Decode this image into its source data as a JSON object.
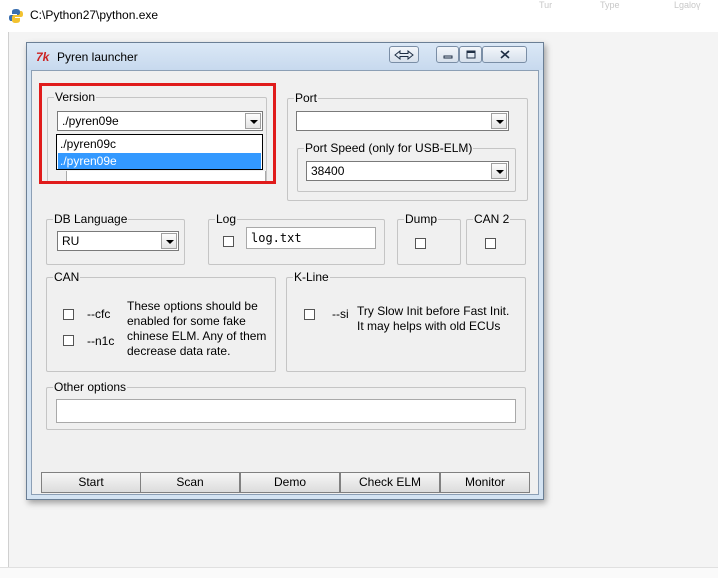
{
  "console": {
    "title": "C:\\Python27\\python.exe",
    "ghost_text": [
      "Tur",
      "Type",
      "Lgaloү"
    ]
  },
  "window": {
    "title": "Pyren launcher"
  },
  "version": {
    "label": "Version",
    "selected": "./pyren09e",
    "options": [
      "./pyren09c",
      "./pyren09e"
    ],
    "highlighted_index": 1
  },
  "port": {
    "label": "Port",
    "value": ""
  },
  "port_speed": {
    "label": "Port Speed (only for USB-ELM)",
    "value": "38400"
  },
  "db_language": {
    "label": "DB Language",
    "value": "RU"
  },
  "log": {
    "label": "Log",
    "file": "log.txt"
  },
  "dump": {
    "label": "Dump"
  },
  "can2": {
    "label": "CAN 2"
  },
  "can": {
    "label": "CAN",
    "opt1": "--cfc",
    "opt2": "--n1c",
    "help_lines": [
      "These options should be",
      "enabled for some fake",
      "chinese ELM. Any of them",
      "decrease data rate."
    ]
  },
  "kline": {
    "label": "K-Line",
    "opt": "--si",
    "help_lines": [
      "Try Slow Init before Fast Init.",
      "It may helps with old ECUs"
    ]
  },
  "other_options": {
    "label": "Other options",
    "value": ""
  },
  "buttons": {
    "start": "Start",
    "scan": "Scan",
    "demo": "Demo",
    "check_elm": "Check ELM",
    "monitor": "Monitor"
  },
  "colors": {
    "highlight_box": "#e01b1b",
    "selection": "#3399ff"
  }
}
